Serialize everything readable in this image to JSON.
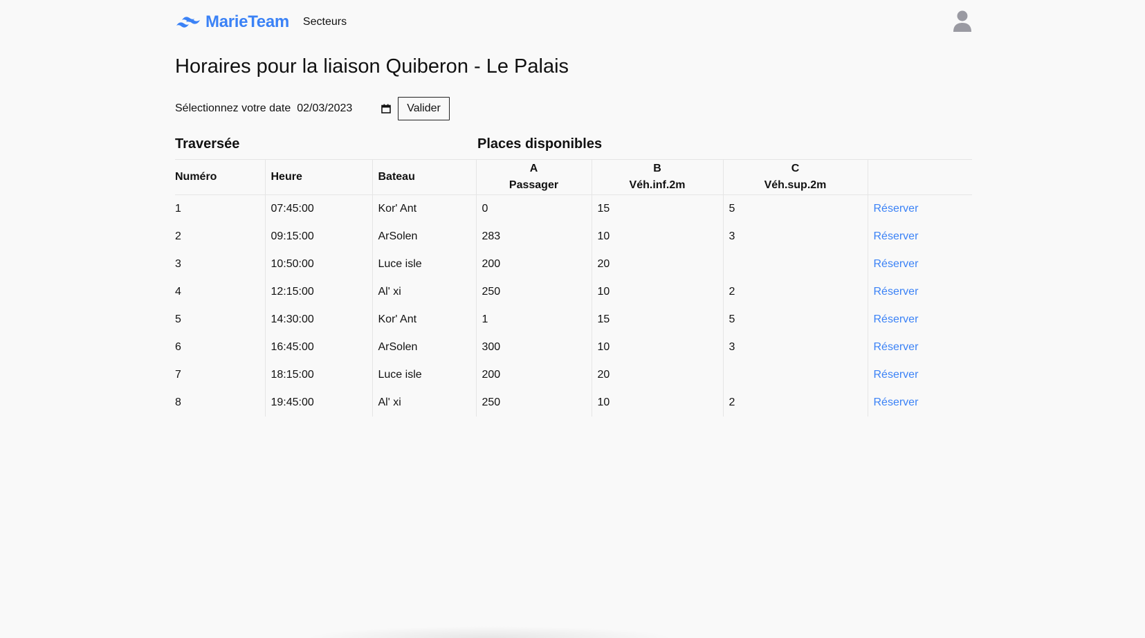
{
  "header": {
    "brand": "MarieTeam",
    "nav_link": "Secteurs",
    "logo_icon": "wave-logo-icon",
    "user_icon": "user-icon",
    "brand_color": "#3b82f6"
  },
  "page": {
    "title": "Horaires pour la liaison Quiberon - Le Palais"
  },
  "date_form": {
    "label": "Sélectionnez votre date",
    "value": "02/03/2023",
    "calendar_icon": "calendar-icon",
    "submit_label": "Valider"
  },
  "table": {
    "group_headers": {
      "traversee": "Traversée",
      "places": "Places disponibles"
    },
    "columns": {
      "numero": "Numéro",
      "heure": "Heure",
      "bateau": "Bateau",
      "a_code": "A",
      "a_label": "Passager",
      "b_code": "B",
      "b_label": "Véh.inf.2m",
      "c_code": "C",
      "c_label": "Véh.sup.2m"
    },
    "action_label": "Réserver",
    "rows": [
      {
        "numero": "1",
        "heure": "07:45:00",
        "bateau": "Kor' Ant",
        "a": "0",
        "b": "15",
        "c": "5"
      },
      {
        "numero": "2",
        "heure": "09:15:00",
        "bateau": "ArSolen",
        "a": "283",
        "b": "10",
        "c": "3"
      },
      {
        "numero": "3",
        "heure": "10:50:00",
        "bateau": "Luce isle",
        "a": "200",
        "b": "20",
        "c": ""
      },
      {
        "numero": "4",
        "heure": "12:15:00",
        "bateau": "Al' xi",
        "a": "250",
        "b": "10",
        "c": "2"
      },
      {
        "numero": "5",
        "heure": "14:30:00",
        "bateau": "Kor' Ant",
        "a": "1",
        "b": "15",
        "c": "5"
      },
      {
        "numero": "6",
        "heure": "16:45:00",
        "bateau": "ArSolen",
        "a": "300",
        "b": "10",
        "c": "3"
      },
      {
        "numero": "7",
        "heure": "18:15:00",
        "bateau": "Luce isle",
        "a": "200",
        "b": "20",
        "c": ""
      },
      {
        "numero": "8",
        "heure": "19:45:00",
        "bateau": "Al' xi",
        "a": "250",
        "b": "10",
        "c": "2"
      }
    ]
  }
}
